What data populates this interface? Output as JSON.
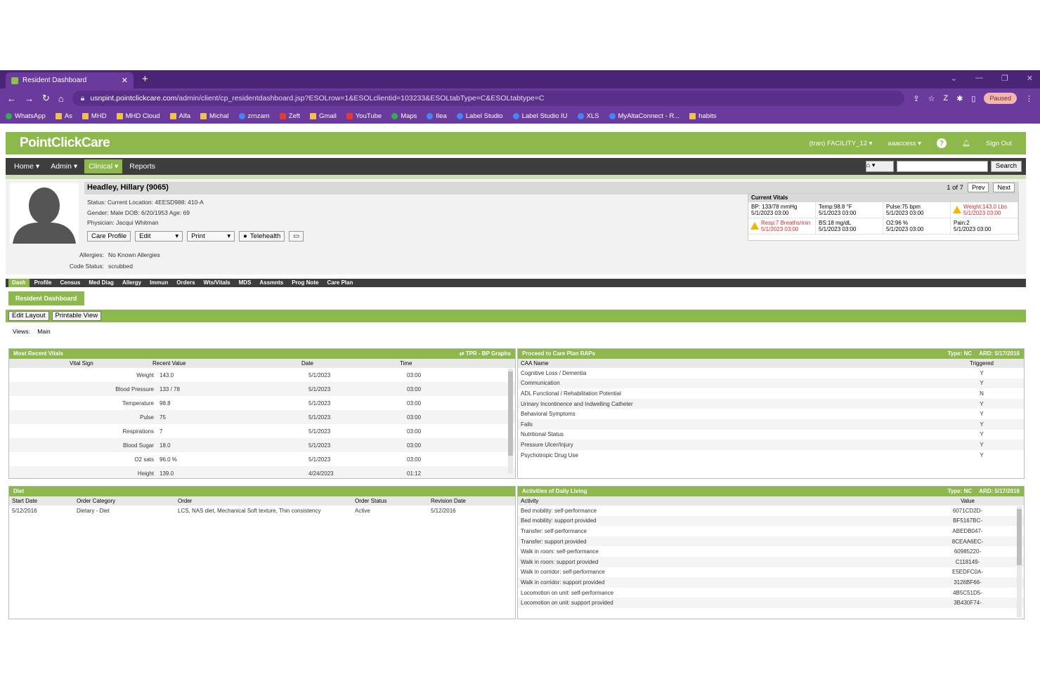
{
  "browser": {
    "tab_title": "Resident Dashboard",
    "new_tab": "+",
    "url_domain": "usnpint.pointclickcare.com",
    "url_path": "/admin/client/cp_residentdashboard.jsp?ESOLrow=1&ESOLclientid=103233&ESOLtabType=C&ESOLtabtype=C",
    "profile_label": "Paused",
    "bookmarks": [
      "WhatsApp",
      "As",
      "MHD",
      "MHD Cloud",
      "Alfa",
      "Michal",
      "zrnzam",
      "Zeft",
      "Gmail",
      "YouTube",
      "Maps",
      "Ilea",
      "Label Studio",
      "Label Studio IU",
      "XLS",
      "MyAltaConnect - R...",
      "habits"
    ]
  },
  "app": {
    "logo": "PointClickCare",
    "facility": "(tran) FACILITY_12",
    "user": "aaaccess",
    "sign_out": "Sign Out",
    "menu": [
      "Home",
      "Admin",
      "Clinical",
      "Reports"
    ],
    "search_button": "Search"
  },
  "patient": {
    "name": "Headley, Hillary (9065)",
    "pager_text": "1 of 7",
    "prev": "Prev",
    "next": "Next",
    "status_line": "Status: Current    Location: 4EESD988: 410-A",
    "gender_line": "Gender: Male    DOB: 6/20/1953    Age: 69",
    "physician_line": "Physician: Jacqui Whitman",
    "buttons": [
      "Care Profile",
      "Edit",
      "Print",
      "Telehealth"
    ],
    "allergies_label": "Allergies:",
    "allergies_value": "No Known Allergies",
    "code_status_label": "Code Status:",
    "code_status_value": "scrubbed"
  },
  "current_vitals": {
    "title": "Current Vitals",
    "cells": [
      {
        "l1": "BP: 133/78 mmHg",
        "l2": "5/1/2023 03:00",
        "alert": false
      },
      {
        "l1": "Temp:98.8 °F",
        "l2": "5/1/2023 03:00",
        "alert": false
      },
      {
        "l1": "Pulse:75 bpm",
        "l2": "5/1/2023 03:00",
        "alert": false
      },
      {
        "l1": "Weight:143.0 Lbs",
        "l2": "5/1/2023 03:00",
        "alert": true
      },
      {
        "l1": "Resp:7 Breaths/min",
        "l2": "5/1/2023 03:00",
        "alert": true
      },
      {
        "l1": "BS:18 mg/dL",
        "l2": "5/1/2023 03:00",
        "alert": false
      },
      {
        "l1": "O2:96 %",
        "l2": "5/1/2023 03:00",
        "alert": false
      },
      {
        "l1": "Pain:2",
        "l2": "5/1/2023 03:00",
        "alert": false
      }
    ]
  },
  "tabs": [
    "Dash",
    "Profile",
    "Census",
    "Med Diag",
    "Allergy",
    "Immun",
    "Orders",
    "Wts/Vitals",
    "MDS",
    "Assmnts",
    "Prog Note",
    "Care Plan"
  ],
  "dashboard": {
    "tab_label": "Resident Dashboard",
    "edit_layout": "Edit Layout",
    "printable_view": "Printable View",
    "views_label": "Views:",
    "views_value": "Main"
  },
  "most_recent_vitals": {
    "title": "Most Recent Vitals",
    "link": "TPR - BP Graphs",
    "columns": [
      "Vital Sign",
      "Recent Value",
      "Date",
      "Time"
    ],
    "rows": [
      {
        "sign": "Weight",
        "value": "143.0",
        "date": "5/1/2023",
        "time": "03:00"
      },
      {
        "sign": "Blood Pressure",
        "value": "133 / 78",
        "date": "5/1/2023",
        "time": "03:00"
      },
      {
        "sign": "Temperature",
        "value": "98.8",
        "date": "5/1/2023",
        "time": "03:00"
      },
      {
        "sign": "Pulse",
        "value": "75",
        "date": "5/1/2023",
        "time": "03:00"
      },
      {
        "sign": "Respirations",
        "value": "7",
        "date": "5/1/2023",
        "time": "03:00"
      },
      {
        "sign": "Blood Sugar",
        "value": "18.0",
        "date": "5/1/2023",
        "time": "03:00"
      },
      {
        "sign": "O2 sats",
        "value": "96.0 %",
        "date": "5/1/2023",
        "time": "03:00"
      },
      {
        "sign": "Height",
        "value": "139.0",
        "date": "4/24/2023",
        "time": "01:12"
      }
    ]
  },
  "care_plan_raps": {
    "title": "Proceed to Care Plan RAPs",
    "type_label": "Type: NC",
    "ard_label": "ARD: 5/17/2016",
    "columns": [
      "CAA Name",
      "Triggered"
    ],
    "rows": [
      {
        "name": "Cognitive Loss / Dementia",
        "trig": "Y"
      },
      {
        "name": "Communication",
        "trig": "Y"
      },
      {
        "name": "ADL Functional / Rehabilitation Potential",
        "trig": "N"
      },
      {
        "name": "Urinary Incontinence and Indwelling Catheter",
        "trig": "Y"
      },
      {
        "name": "Behavioral Symptoms",
        "trig": "Y"
      },
      {
        "name": "Falls",
        "trig": "Y"
      },
      {
        "name": "Nutritional Status",
        "trig": "Y"
      },
      {
        "name": "Pressure Ulcer/Injury",
        "trig": "Y"
      },
      {
        "name": "Psychotropic Drug Use",
        "trig": "Y"
      }
    ]
  },
  "diet": {
    "title": "Diet",
    "columns": [
      "Start Date",
      "Order Category",
      "Order",
      "Order Status",
      "Revision Date"
    ],
    "rows": [
      {
        "start": "5/12/2016",
        "category": "Dietary - Diet",
        "order": "LCS, NAS diet, Mechanical Soft texture, Thin consistency",
        "status": "Active",
        "revision": "5/12/2016"
      }
    ]
  },
  "adl": {
    "title": "Activities of Daily Living",
    "type_label": "Type: NC",
    "ard_label": "ARD: 5/17/2016",
    "columns": [
      "Activity",
      "Value"
    ],
    "rows": [
      {
        "activity": "Bed mobility: self-performance",
        "value": "6071CD2D-"
      },
      {
        "activity": "Bed mobility: support provided",
        "value": "BF5167BC-"
      },
      {
        "activity": "Transfer: self-performance",
        "value": "ABEDB047-"
      },
      {
        "activity": "Transfer: support provided",
        "value": "8CEAA6EC-"
      },
      {
        "activity": "Walk in room: self-performance",
        "value": "60985220-"
      },
      {
        "activity": "Walk in room: support provided",
        "value": "C118149-"
      },
      {
        "activity": "Walk in corridor: self-performance",
        "value": "E5EDFC0A-"
      },
      {
        "activity": "Walk in corridor: support provided",
        "value": "3126BF66-"
      },
      {
        "activity": "Locomotion on unit: self-performance",
        "value": "4B5C51D5-"
      },
      {
        "activity": "Locomotion on unit: support provided",
        "value": "3B430F74-"
      }
    ]
  }
}
